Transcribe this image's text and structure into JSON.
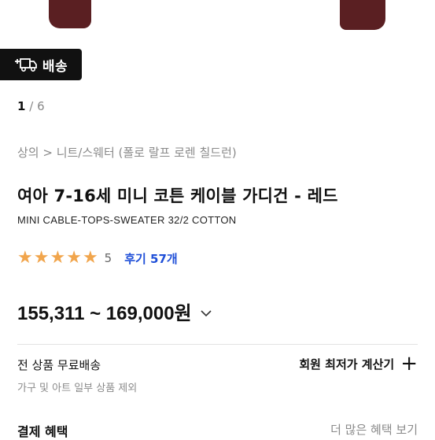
{
  "badge": {
    "icon": "delivery-truck-icon",
    "label": "배송"
  },
  "pager": {
    "current": "1",
    "separator": "/",
    "total": "6"
  },
  "breadcrumb": "상의 > 니트/스웨터 (폴로 랄프 로렌 칠드런)",
  "product": {
    "title": "여아 7-16세 미니 코튼 케이블 가디건 - 레드",
    "subtitle": "MINI CABLE-TOPS-SWEATER 32/2 COTTON",
    "rating": 5,
    "rating_text": "5",
    "reviews": "후기 57개",
    "price_range": "155,311 ~ 169,000원"
  },
  "shipping": {
    "label": "전 상품 무료배송",
    "note": "가구 및 아트 일부 상품 제외"
  },
  "member_calc": {
    "label": "회원 최저가 계산기",
    "icon": "plus-icon"
  },
  "benefits": {
    "title": "결제 혜택",
    "more": "더 많은 혜택 보기"
  },
  "colors": {
    "star": "#f1a54c",
    "review_link": "#1f4fd8",
    "sweater": "#5a1f22"
  }
}
